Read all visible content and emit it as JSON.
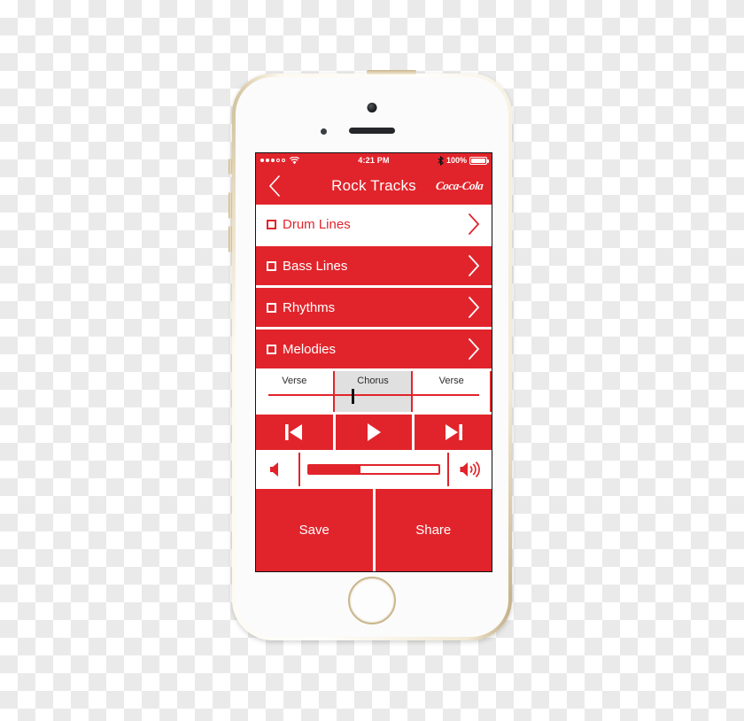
{
  "background": {
    "type": "transparency-checkerboard",
    "colors": [
      "#ffffff",
      "#eaeaea"
    ]
  },
  "device": {
    "model": "iPhone 5s",
    "body_color": "white-gold",
    "accent_color": "#e1242b"
  },
  "status_bar": {
    "signal_filled": 3,
    "signal_total": 5,
    "wifi_icon": "wifi-icon",
    "time": "4:21 PM",
    "bluetooth_icon": "bluetooth-icon",
    "battery_percent": "100%",
    "battery_level": 100
  },
  "nav_bar": {
    "back_icon": "chevron-left-icon",
    "title": "Rock Tracks",
    "brand": "Coca-Cola"
  },
  "tracks": [
    {
      "label": "Drum Lines",
      "checked": false,
      "selected": true
    },
    {
      "label": "Bass Lines",
      "checked": false,
      "selected": false
    },
    {
      "label": "Rhythms",
      "checked": false,
      "selected": false
    },
    {
      "label": "Melodies",
      "checked": false,
      "selected": false
    }
  ],
  "sections": [
    {
      "label": "Verse",
      "active": false
    },
    {
      "label": "Chorus",
      "active": true
    },
    {
      "label": "Verse",
      "active": false
    }
  ],
  "playhead_position_percent": 40.5,
  "transport": [
    {
      "name": "previous-track",
      "icon": "skip-previous-icon"
    },
    {
      "name": "play",
      "icon": "play-icon"
    },
    {
      "name": "next-track",
      "icon": "skip-next-icon"
    }
  ],
  "volume": {
    "mute_icon": "volume-low-icon",
    "max_icon": "volume-high-icon",
    "level_percent": 40
  },
  "actions": [
    {
      "label": "Save",
      "name": "save-button"
    },
    {
      "label": "Share",
      "name": "share-button"
    }
  ]
}
